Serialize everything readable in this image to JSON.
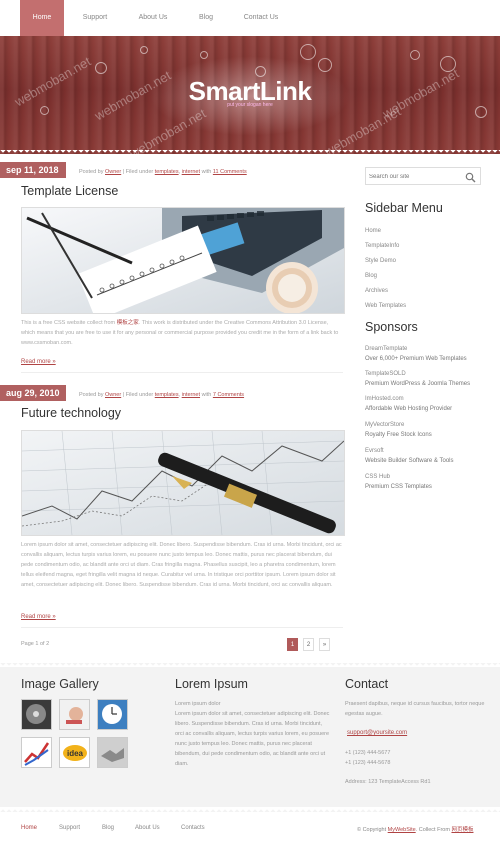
{
  "nav": {
    "items": [
      {
        "label": "Home"
      },
      {
        "label": "Support"
      },
      {
        "label": "About Us"
      },
      {
        "label": "Blog"
      },
      {
        "label": "Contact Us"
      }
    ]
  },
  "header": {
    "logo": "SmartLink",
    "slogan": "put your slogan here",
    "watermarks": [
      "webmoban.net",
      "webmoban.net",
      "webmoban.net",
      "webmoban.net",
      "webmoban.net"
    ]
  },
  "posts": [
    {
      "date": "sep 11, 2018",
      "meta": {
        "posted_by": "Posted by",
        "author": "Owner",
        "filed": "| Filed under",
        "categories": "templates",
        "comma": ", ",
        "category2": "internet",
        "with": "with",
        "comments": "11 Comments"
      },
      "title": "Template License",
      "text_a": "This is a free CSS website collect from",
      "text_link": "模板之家",
      "text_b": ". This work is distributed under the Creative Commons Attribution 3.0 License, which means that you are free to use it for any personal or commercial purpose provided you credit me in the form of a link back to www.cssmoban.com.",
      "read_more": "Read more »"
    },
    {
      "date": "aug 29, 2010",
      "meta": {
        "posted_by": "Posted by",
        "author": "Owner",
        "filed": "| Filed under",
        "categories": "templates",
        "comma": ", ",
        "category2": "internet",
        "with": "with",
        "comments": "7 Comments"
      },
      "title": "Future technology",
      "text": "Lorem ipsum dolor sit amet, consectetuer adipiscing elit. Donec libero. Suspendisse bibendum. Cras id urna. Morbi tincidunt, orci ac convallis aliquam, lectus turpis varius lorem, eu posuere nunc justo tempus leo. Donec mattis, purus nec placerat bibendum, dui pede condimentum odio, ac blandit ante orci ut diam. Cras fringilla magna. Phasellus suscipit, leo a pharetra condimentum, lorem tellus eleifend magna, eget fringilla velit magna id neque. Curabitur vel urna. In tristique orci porttitor ipsum. Lorem ipsum dolor sit amet, consectetuer adipiscing elit. Donec libero. Suspendisse bibendum. Cras id urna. Morbi tincidunt, orci ac convallis aliquam.",
      "read_more": "Read more »"
    }
  ],
  "pagination": {
    "info": "Page 1 of 2",
    "pages": [
      "1",
      "2",
      "»"
    ]
  },
  "sidebar": {
    "search_placeholder": "Search our site",
    "menu_title": "Sidebar Menu",
    "menu": [
      "Home",
      "TemplateInfo",
      "Style Demo",
      "Blog",
      "Archives",
      "Web Templates"
    ],
    "sponsors_title": "Sponsors",
    "sponsors": [
      {
        "title": "DreamTemplate",
        "desc": "Over 6,000+ Premium Web Templates"
      },
      {
        "title": "TemplateSOLD",
        "desc": "Premium WordPress & Joomla Themes"
      },
      {
        "title": "ImHosted.com",
        "desc": "Affordable Web Hosting Provider"
      },
      {
        "title": "MyVectorStore",
        "desc": "Royalty Free Stock Icons"
      },
      {
        "title": "Evrsoft",
        "desc": "Website Builder Software & Tools"
      },
      {
        "title": "CSS Hub",
        "desc": "Premium CSS Templates"
      }
    ]
  },
  "footer": {
    "gallery_title": "Image Gallery",
    "lorem_title": "Lorem Ipsum",
    "lorem_lead": "Lorem ipsum dolor",
    "lorem_text": "Lorem ipsum dolor sit amet, consectetuer adipiscing elit. Donec libero. Suspendisse bibendum. Cras id urna. Morbi tincidunt, orci ac convallis aliquam, lectus turpis varius lorem, eu posuere nunc justo tempus leo. Donec mattis, purus nec placerat bibendum, dui pede condimentum odio, ac blandit ante orci ut diam.",
    "contact_title": "Contact",
    "contact_text": "Praesent dapibus, neque id cursus faucibus, tortor neque egestas augue.",
    "contact_email": "support@yoursite.com",
    "phone1": "+1 (123) 444-5677",
    "phone2": "+1 (123) 444-5678",
    "address": "Address: 123 TemplateAccess Rd1"
  },
  "bottom": {
    "nav": [
      "Home",
      "Support",
      "Blog",
      "About Us",
      "Contacts"
    ],
    "copyright_pre": "© Copyright",
    "copyright_site": "MyWebSite",
    "copyright_mid": ". Collect From",
    "copyright_link": "网页模板"
  }
}
